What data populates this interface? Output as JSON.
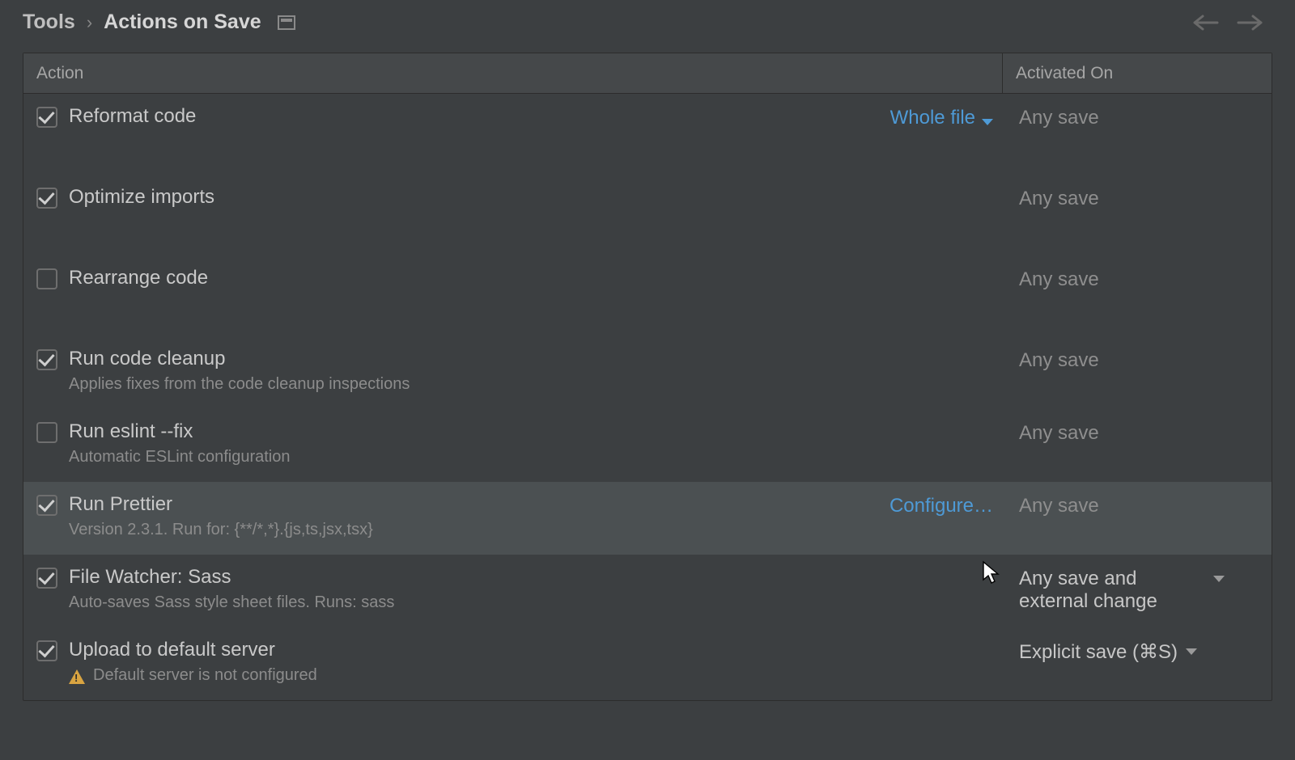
{
  "breadcrumb": {
    "parent": "Tools",
    "separator": "›",
    "current": "Actions on Save"
  },
  "columns": {
    "action": "Action",
    "activated": "Activated On"
  },
  "rows": [
    {
      "checked": true,
      "title": "Reformat code",
      "subtitle": "",
      "inlineLink": "Whole file",
      "inlineLinkHasChevron": true,
      "activated": "Any save",
      "activatedBright": false,
      "activatedChevron": false,
      "selected": false,
      "warn": false
    },
    {
      "checked": true,
      "title": "Optimize imports",
      "subtitle": "",
      "inlineLink": "",
      "inlineLinkHasChevron": false,
      "activated": "Any save",
      "activatedBright": false,
      "activatedChevron": false,
      "selected": false,
      "warn": false
    },
    {
      "checked": false,
      "title": "Rearrange code",
      "subtitle": "",
      "inlineLink": "",
      "inlineLinkHasChevron": false,
      "activated": "Any save",
      "activatedBright": false,
      "activatedChevron": false,
      "selected": false,
      "warn": false
    },
    {
      "checked": true,
      "title": "Run code cleanup",
      "subtitle": "Applies fixes from the code cleanup inspections",
      "inlineLink": "",
      "inlineLinkHasChevron": false,
      "activated": "Any save",
      "activatedBright": false,
      "activatedChevron": false,
      "selected": false,
      "warn": false
    },
    {
      "checked": false,
      "title": "Run eslint --fix",
      "subtitle": "Automatic ESLint configuration",
      "inlineLink": "",
      "inlineLinkHasChevron": false,
      "activated": "Any save",
      "activatedBright": false,
      "activatedChevron": false,
      "selected": false,
      "warn": false
    },
    {
      "checked": true,
      "title": "Run Prettier",
      "subtitle": "Version 2.3.1. Run for: {**/*,*}.{js,ts,jsx,tsx}",
      "inlineLink": "Configure…",
      "inlineLinkHasChevron": false,
      "activated": "Any save",
      "activatedBright": false,
      "activatedChevron": false,
      "selected": true,
      "warn": false
    },
    {
      "checked": true,
      "title": "File Watcher: Sass",
      "subtitle": "Auto-saves Sass style sheet files. Runs: sass",
      "inlineLink": "",
      "inlineLinkHasChevron": false,
      "activated": "Any save and external change",
      "activatedBright": true,
      "activatedChevron": true,
      "selected": false,
      "warn": false
    },
    {
      "checked": true,
      "title": "Upload to default server",
      "subtitle": "Default server is not configured",
      "inlineLink": "",
      "inlineLinkHasChevron": false,
      "activated": "Explicit save (⌘S)",
      "activatedBright": true,
      "activatedChevron": true,
      "selected": false,
      "warn": true
    }
  ]
}
